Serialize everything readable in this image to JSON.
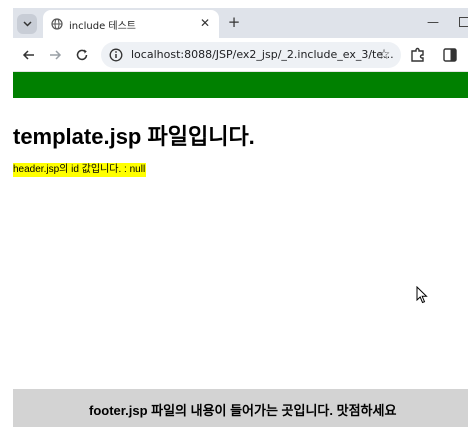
{
  "browser": {
    "tab": {
      "title": "include 테스트",
      "favicon": "globe-icon",
      "close_icon": "close-icon"
    },
    "new_tab_icon": "plus-icon",
    "window_controls": {
      "minimize_icon": "minimize-icon"
    },
    "toolbar": {
      "back_icon": "arrow-left-icon",
      "forward_icon": "arrow-right-icon",
      "reload_icon": "reload-icon",
      "site_info_icon": "site-info-icon",
      "url": "localhost:8088/JSP/ex2_jsp/_2.include_ex_3/te...",
      "bookmark_icon": "star-icon",
      "extensions_icon": "puzzle-icon",
      "side_panel_icon": "side-panel-icon"
    }
  },
  "page": {
    "header_color": "#008000",
    "heading": "template.jsp 파일입니다.",
    "id_line": "header.jsp의 id 값입니다. : null",
    "id_line_highlight": "#ffff00",
    "footer_text": "footer.jsp 파일의 내용이 들어가는 곳입니다. 맛점하세요",
    "footer_background": "#d3d3d3"
  }
}
